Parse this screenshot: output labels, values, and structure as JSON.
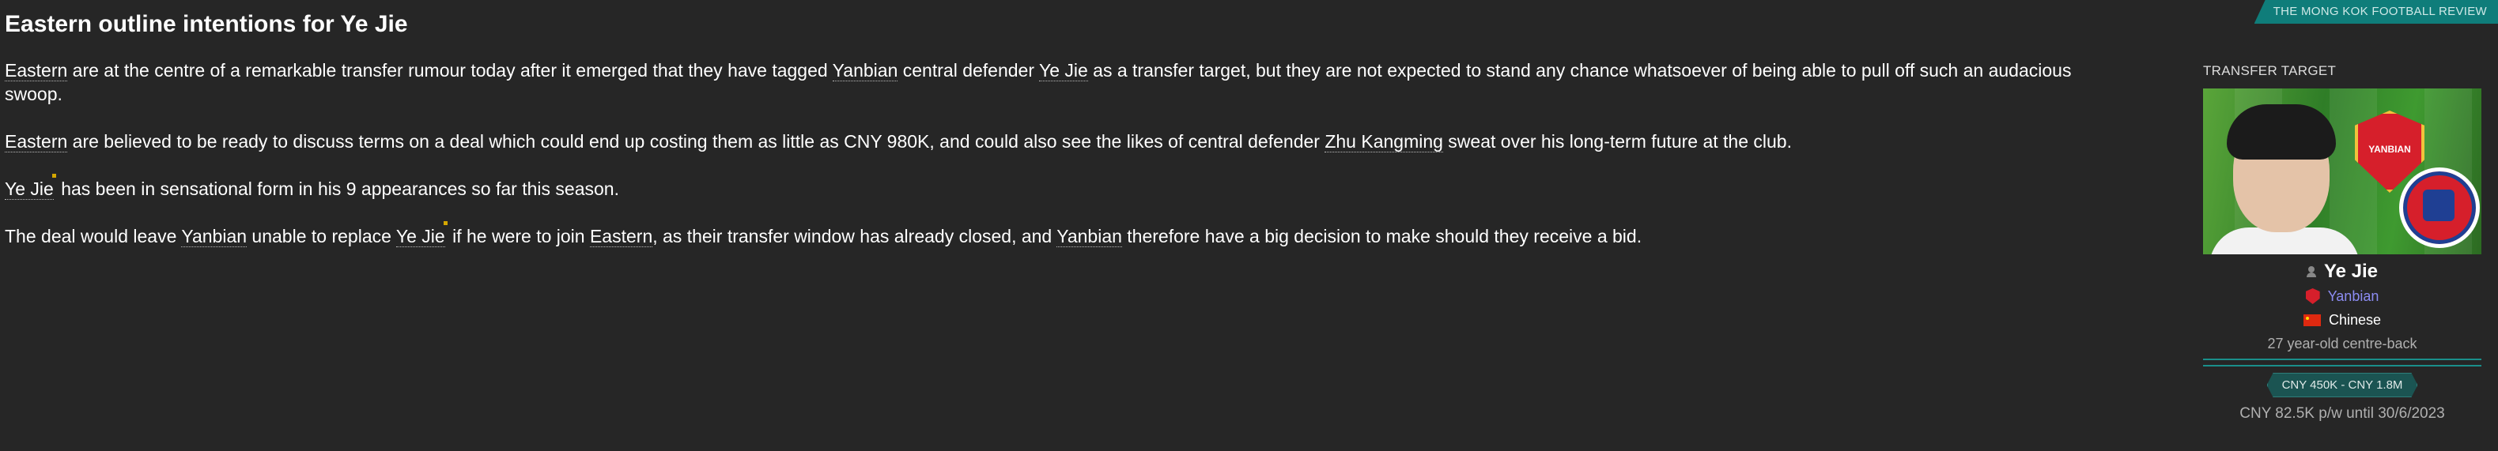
{
  "source": "THE MONG KOK FOOTBALL REVIEW",
  "article": {
    "headline": "Eastern outline intentions for Ye Jie",
    "p1": {
      "t1": "Eastern",
      "t2": " are at the centre of a remarkable transfer rumour today after it emerged that they have tagged ",
      "t3": "Yanbian",
      "t4": " central defender ",
      "t5": "Ye Jie",
      "t6": " as a transfer target, but they are not expected to stand any chance whatsoever of being able to pull off such an audacious swoop."
    },
    "p2": {
      "t1": "Eastern",
      "t2": " are believed to be ready to discuss terms on a deal which could end up costing them as little as CNY 980K, and could also see the likes of central defender ",
      "t3": "Zhu Kangming",
      "t4": " sweat over his long-term future at the club."
    },
    "p3": {
      "t1": "Ye Jie",
      "t2": " has been in sensational form in his 9 appearances so far this season."
    },
    "p4": {
      "t1": "The deal would leave ",
      "t2": "Yanbian",
      "t3": " unable to replace ",
      "t4": "Ye Jie",
      "t5": " if he were to join ",
      "t6": "Eastern",
      "t7": ", as their transfer window has already closed, and ",
      "t8": "Yanbian",
      "t9": " therefore have a big decision to make should they receive a bid."
    }
  },
  "sidebar": {
    "heading": "TRANSFER TARGET",
    "badge_text": "YANBIAN",
    "player_name": "Ye Jie",
    "club": "Yanbian",
    "nationality": "Chinese",
    "role": "27 year-old centre-back",
    "value_range": "CNY 450K - CNY 1.8M",
    "contract": "CNY 82.5K p/w until 30/6/2023",
    "colors": {
      "accent": "#0f7d7a",
      "club_link": "#8c8cf2",
      "club_red": "#d61f2b"
    }
  }
}
